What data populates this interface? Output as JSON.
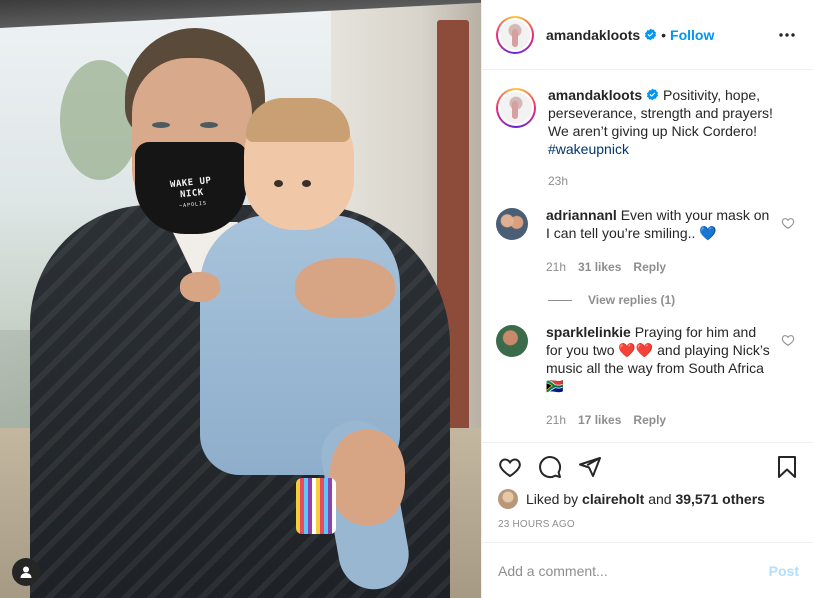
{
  "post": {
    "username": "amandakloots",
    "follow_label": "Follow",
    "separator": "•",
    "caption": {
      "username": "amandakloots",
      "text": "Positivity, hope, perseverance, strength and prayers! We aren’t giving up Nick Cordero!",
      "hashtag": "#wakeupnick",
      "time": "23h"
    },
    "mask_text": "WAKE UP NICK",
    "mask_sub": "~APOLIS",
    "comments": [
      {
        "username": "adriannanl",
        "text": "Even with your mask on I can tell you’re smiling.. 💙",
        "time": "21h",
        "likes": "31 likes",
        "reply": "Reply",
        "view_replies": "View replies (1)"
      },
      {
        "username": "sparklelinkie",
        "text": "Praying for him and for you two ❤️❤️ and playing Nick’s music all the way from South Africa 🇿🇦",
        "time": "21h",
        "likes": "17 likes",
        "reply": "Reply"
      }
    ],
    "likes": {
      "prefix": "Liked by",
      "user": "claireholt",
      "joiner": "and",
      "others": "39,571 others"
    },
    "timestamp": "23 HOURS AGO",
    "add_comment": {
      "placeholder": "Add a comment...",
      "post_label": "Post"
    },
    "colors": {
      "link": "#0095f6",
      "hashtag": "#00376b",
      "muted": "#8e8e8e",
      "post_disabled": "#b2dffc"
    },
    "icons": [
      "more-icon",
      "heart-icon",
      "comment-icon",
      "share-icon",
      "bookmark-icon",
      "user-tag-icon",
      "verified-icon"
    ]
  }
}
